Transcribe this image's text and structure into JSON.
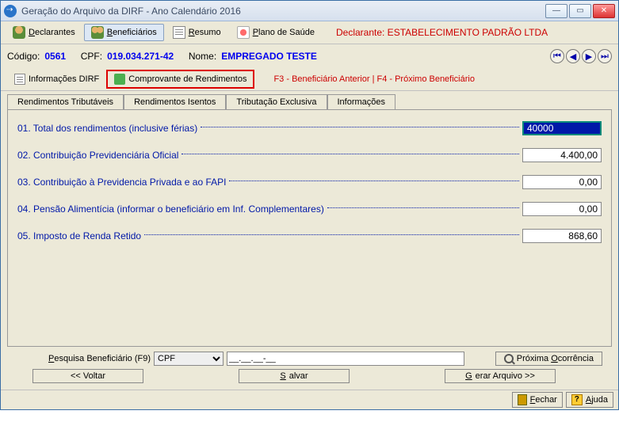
{
  "window": {
    "title": "Geração do Arquivo da DIRF - Ano Calendário 2016"
  },
  "toolbar": {
    "declarantes": "Declarantes",
    "beneficiarios": "Beneficiários",
    "resumo": "Resumo",
    "plano": "Plano de Saúde",
    "declarante_label": "Declarante: ESTABELECIMENTO PADRÃO LTDA"
  },
  "info": {
    "codigo_label": "Código:",
    "codigo": "0561",
    "cpf_label": "CPF:",
    "cpf": "019.034.271-42",
    "nome_label": "Nome:",
    "nome": "EMPREGADO TESTE"
  },
  "subtabs": {
    "informacoes_dirf": "Informações DIRF",
    "comprovante": "Comprovante de Rendimentos",
    "nav_text": "F3 - Beneficiário Anterior | F4 - Próximo Beneficiário"
  },
  "inner_tabs": {
    "tributaveis": "Rendimentos Tributáveis",
    "isentos": "Rendimentos Isentos",
    "exclusiva": "Tributação Exclusiva",
    "informacoes": "Informações"
  },
  "fields": [
    {
      "label": "01. Total dos rendimentos (inclusive férias)",
      "value": "40000",
      "active": true
    },
    {
      "label": "02. Contribuição Previdenciária Oficial",
      "value": "4.400,00",
      "active": false
    },
    {
      "label": "03. Contribuição à Previdencia Privada e ao FAPI",
      "value": "0,00",
      "active": false
    },
    {
      "label": "04. Pensão Alimentícia (informar o beneficiário em Inf. Complementares)",
      "value": "0,00",
      "active": false
    },
    {
      "label": "05. Imposto de Renda Retido",
      "value": "868,60",
      "active": false
    }
  ],
  "search": {
    "label": "Pesquisa Beneficiário (F9)",
    "type": "CPF",
    "placeholder": "__.__.__-__",
    "proxima": "Próxima Ocorrência"
  },
  "buttons": {
    "voltar": "<< Voltar",
    "salvar": "Salvar",
    "gerar": "Gerar Arquivo >>",
    "fechar": "Fechar",
    "ajuda": "Ajuda"
  }
}
